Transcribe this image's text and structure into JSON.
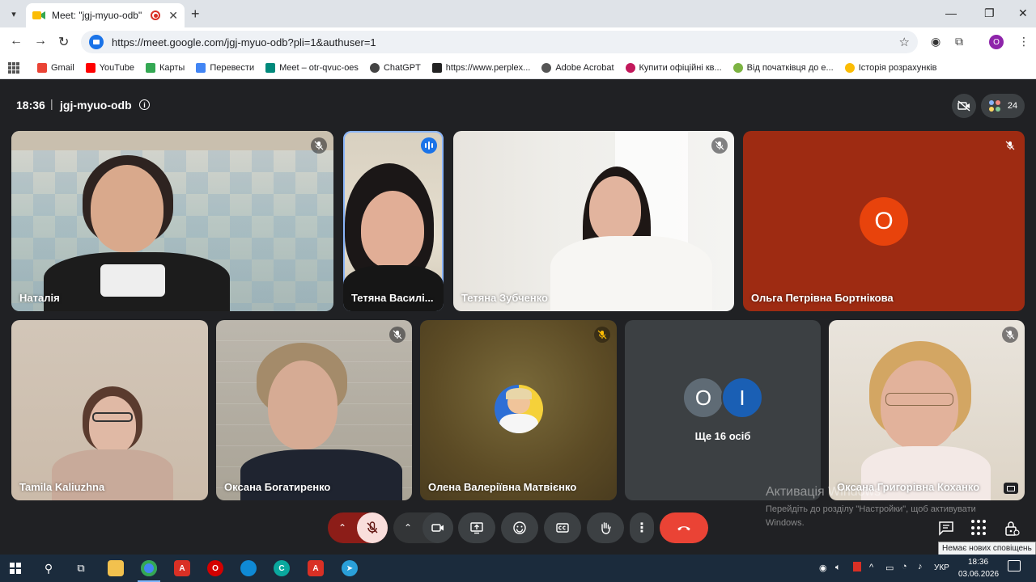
{
  "browser": {
    "tab_title": "Meet: \"jgj-myuo-odb\"",
    "url": "https://meet.google.com/jgj-myuo-odb?pli=1&authuser=1",
    "profile_initial": "O",
    "bookmarks": [
      {
        "label": "Gmail",
        "color": "#ea4335"
      },
      {
        "label": "YouTube",
        "color": "#ff0000"
      },
      {
        "label": "Карты",
        "color": "#34a853"
      },
      {
        "label": "Перевести",
        "color": "#4285f4"
      },
      {
        "label": "Meet – otr-qvuc-oes",
        "color": "#00897b"
      },
      {
        "label": "ChatGPT",
        "color": "#444444"
      },
      {
        "label": "https://www.perplex...",
        "color": "#222222"
      },
      {
        "label": "Adobe Acrobat",
        "color": "#555555"
      },
      {
        "label": "Купити офіційні кв...",
        "color": "#c2185b"
      },
      {
        "label": "Від початківця до е...",
        "color": "#7cb342"
      },
      {
        "label": "Історія розрахунків",
        "color": "#fbbc04"
      }
    ]
  },
  "meet": {
    "time": "18:36",
    "separator": "|",
    "code": "jgj-myuo-odb",
    "participants_count": "24",
    "tiles": [
      {
        "name": "Наталія",
        "state": "muted"
      },
      {
        "name": "Тетяна Василі...",
        "state": "speaking"
      },
      {
        "name": "Тетяна Зубченко",
        "state": "muted"
      },
      {
        "name": "Ольга Петрівна Бортнікова",
        "state": "muted",
        "avatar": "О"
      },
      {
        "name": "Tamila Kaliuzhna",
        "state": "none"
      },
      {
        "name": "Оксана Богатиренко",
        "state": "muted"
      },
      {
        "name": "Олена Валеріївна Матвієнко",
        "state": "muted"
      },
      {
        "name": "Оксана Григорівна Коханко",
        "state": "muted"
      }
    ],
    "others": {
      "label": "Ще 16 осіб",
      "bubble1": "О",
      "bubble2": "І"
    },
    "activation": {
      "title": "Активація Windows",
      "line1": "Перейдіть до розділу \"Настройки\", щоб активувати",
      "line2": "Windows."
    },
    "tooltip": "Немає нових сповіщень"
  },
  "taskbar": {
    "lang": "УКР",
    "clock_time": "18:36",
    "clock_date": "03.06.2026"
  },
  "colors": {
    "meet_bg": "#202124",
    "tile_dark": "#3c4043",
    "end_call": "#ea4335",
    "mic_off_bg": "#f9dedc",
    "accent": "#1a73e8"
  }
}
